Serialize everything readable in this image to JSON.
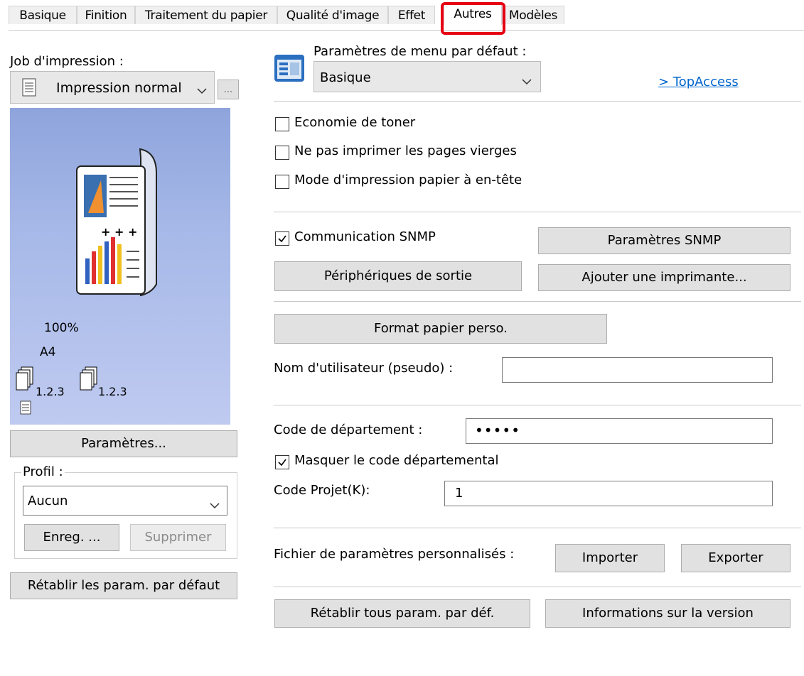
{
  "tabs": [
    "Basique",
    "Finition",
    "Traitement du papier",
    "Qualité d'image",
    "Effet",
    "Autres",
    "Modèles"
  ],
  "active_tab": "Autres",
  "left": {
    "job_label": "Job d'impression :",
    "job_value": "Impression normal",
    "job_more": "...",
    "preview": {
      "zoom": "100%",
      "paper": "A4",
      "collate1": "1.2.3",
      "collate2": "1.2.3"
    },
    "settings_button": "Paramètres...",
    "profile_label": "Profil :",
    "profile_value": "Aucun",
    "save_button": "Enreg. ...",
    "delete_button": "Supprimer",
    "restore_button": "Rétablir les param. par défaut"
  },
  "right": {
    "menu_label": "Paramètres de menu par défaut :",
    "menu_value": "Basique",
    "topaccess_link": "> TopAccess",
    "checkboxes": [
      {
        "label": "Economie de toner",
        "checked": false
      },
      {
        "label": "Ne pas imprimer les pages vierges",
        "checked": false
      },
      {
        "label": "Mode d'impression papier à en-tête",
        "checked": false
      }
    ],
    "snmp": {
      "label": "Communication SNMP",
      "checked": true
    },
    "snmp_settings_button": "Paramètres SNMP",
    "output_devices_button": "Périphériques de sortie",
    "add_printer_button": "Ajouter une imprimante...",
    "custom_paper_button": "Format papier perso.",
    "username_label": "Nom d'utilisateur (pseudo) :",
    "username_value": "",
    "dept_code_label": "Code de département :",
    "dept_code_value": "•••••",
    "mask_dept": {
      "label": "Masquer le code départemental",
      "checked": true
    },
    "project_code_label": "Code Projet(K):",
    "project_code_value": "1",
    "custom_file_label": "Fichier de paramètres personnalisés :",
    "import_button": "Importer",
    "export_button": "Exporter",
    "restore_all_button": "Rétablir tous param. par déf.",
    "version_info_button": "Informations sur la version"
  }
}
